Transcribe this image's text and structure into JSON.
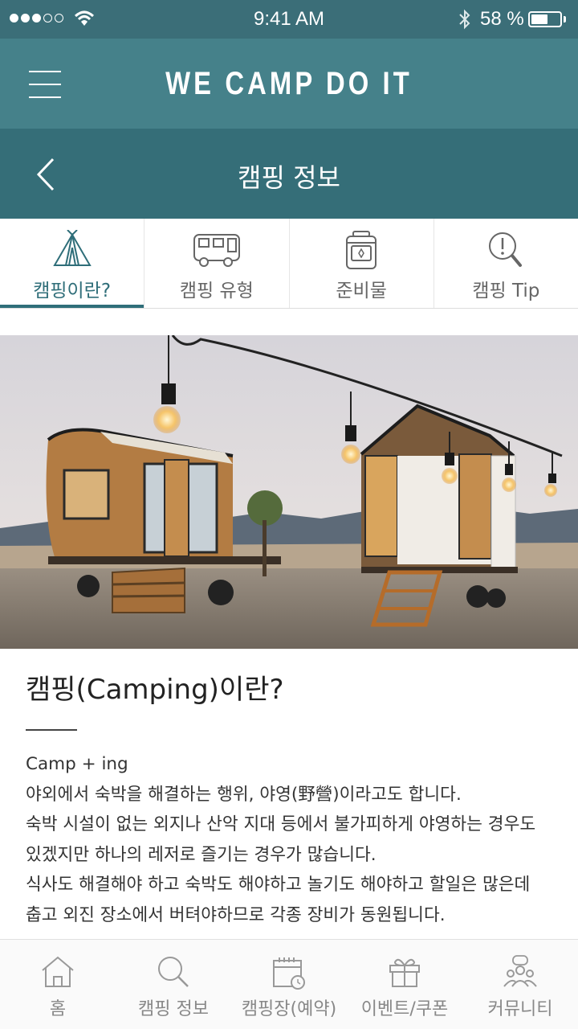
{
  "status_bar": {
    "time": "9:41 AM",
    "battery_text": "58 %",
    "battery_level": 0.58
  },
  "header": {
    "brand": "WE CAMP DO IT"
  },
  "sub_header": {
    "title": "캠핑 정보"
  },
  "tabs": [
    {
      "label": "캠핑이란?",
      "icon": "tent-icon",
      "active": true
    },
    {
      "label": "캠핑 유형",
      "icon": "camper-van-icon",
      "active": false
    },
    {
      "label": "준비물",
      "icon": "backpack-icon",
      "active": false
    },
    {
      "label": "캠핑 Tip",
      "icon": "tip-search-icon",
      "active": false
    }
  ],
  "article": {
    "title": "캠핑(Camping)이란?",
    "lines": [
      "Camp + ing",
      "야외에서 숙박을 해결하는 행위, 야영(野營)이라고도 합니다.",
      "숙박 시설이 없는 외지나 산악 지대 등에서 불가피하게 야영하는 경우도",
      "있겠지만 하나의 레저로 즐기는 경우가 많습니다.",
      "식사도 해결해야 하고 숙박도 해야하고 놀기도 해야하고 할일은 많은데",
      "춥고 외진 장소에서 버텨야하므로 각종 장비가 동원됩니다."
    ]
  },
  "bottom_nav": [
    {
      "label": "홈",
      "icon": "home-icon"
    },
    {
      "label": "캠핑 정보",
      "icon": "search-icon"
    },
    {
      "label": "캠핑장(예약)",
      "icon": "calendar-icon"
    },
    {
      "label": "이벤트/쿠폰",
      "icon": "gift-icon"
    },
    {
      "label": "커뮤니티",
      "icon": "community-icon"
    }
  ],
  "colors": {
    "status_bar": "#3b6e78",
    "header": "#45818a",
    "sub_header": "#356e78",
    "accent": "#2f6e79"
  }
}
